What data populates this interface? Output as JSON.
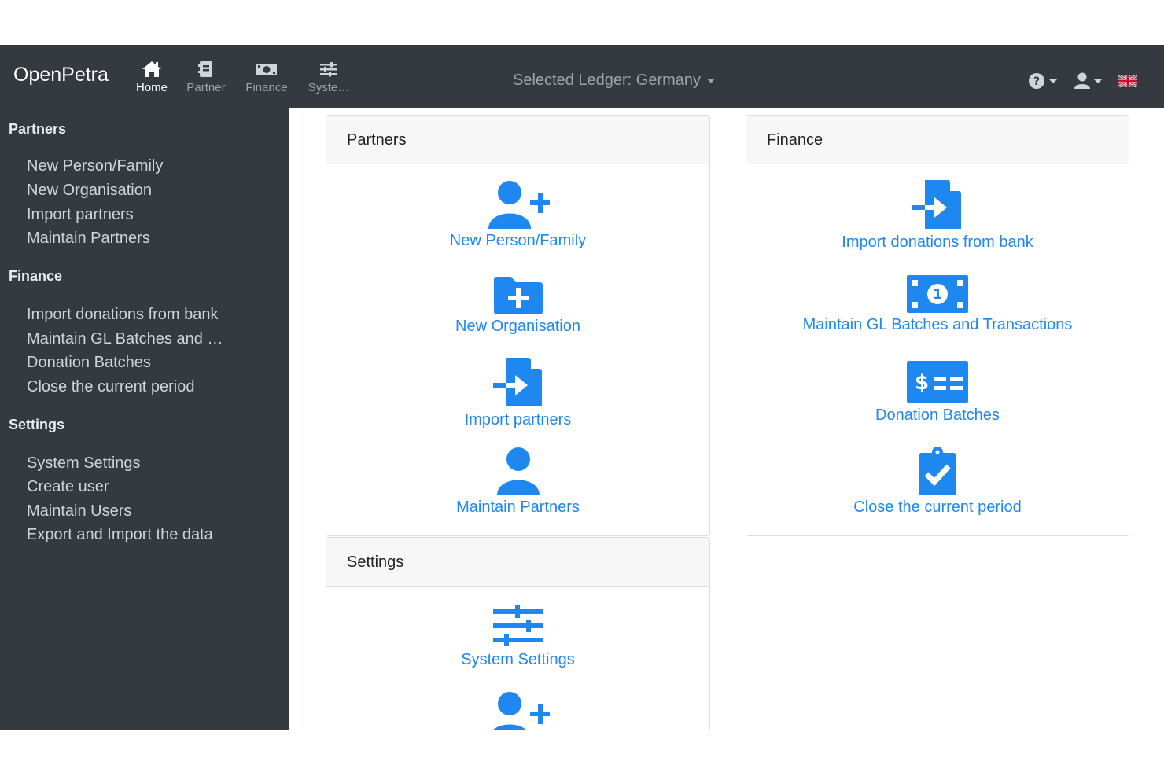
{
  "app": {
    "brand": "OpenPetra"
  },
  "nav": [
    {
      "label": "Home",
      "icon": "home-icon",
      "active": true
    },
    {
      "label": "Partner",
      "icon": "address-book-icon",
      "active": false
    },
    {
      "label": "Finance",
      "icon": "money-bill-icon",
      "active": false
    },
    {
      "label": "Syste…",
      "icon": "sliders-icon",
      "active": false
    }
  ],
  "ledger": {
    "label": "Selected Ledger: Germany"
  },
  "topright": {
    "help_icon": "question-circle-icon",
    "user_icon": "user-icon",
    "language_icon": "uk-flag-icon"
  },
  "sidebar": {
    "sections": [
      {
        "title": "Partners",
        "items": [
          "New Person/Family",
          "New Organisation",
          "Import partners",
          "Maintain Partners"
        ]
      },
      {
        "title": "Finance",
        "items": [
          "Import donations from bank",
          "Maintain GL Batches and …",
          "Donation Batches",
          "Close the current period"
        ]
      },
      {
        "title": "Settings",
        "items": [
          "System Settings",
          "Create user",
          "Maintain Users",
          "Export and Import the data"
        ]
      }
    ]
  },
  "cards": {
    "partners": {
      "title": "Partners",
      "tiles": [
        {
          "label": "New Person/Family",
          "icon": "user-plus-icon"
        },
        {
          "label": "New Organisation",
          "icon": "folder-plus-icon"
        },
        {
          "label": "Import partners",
          "icon": "file-import-icon"
        },
        {
          "label": "Maintain Partners",
          "icon": "user-icon"
        }
      ]
    },
    "finance": {
      "title": "Finance",
      "tiles": [
        {
          "label": "Import donations from bank",
          "icon": "file-import-icon"
        },
        {
          "label": "Maintain GL Batches and Transactions",
          "icon": "money-bill-icon"
        },
        {
          "label": "Donation Batches",
          "icon": "money-check-icon"
        },
        {
          "label": "Close the current period",
          "icon": "clipboard-check-icon"
        }
      ]
    },
    "settings": {
      "title": "Settings",
      "tiles": [
        {
          "label": "System Settings",
          "icon": "sliders-icon"
        },
        {
          "label": "",
          "icon": "user-plus-icon"
        }
      ]
    }
  },
  "colors": {
    "accent": "#1e87f0",
    "navbar": "#343a40"
  }
}
